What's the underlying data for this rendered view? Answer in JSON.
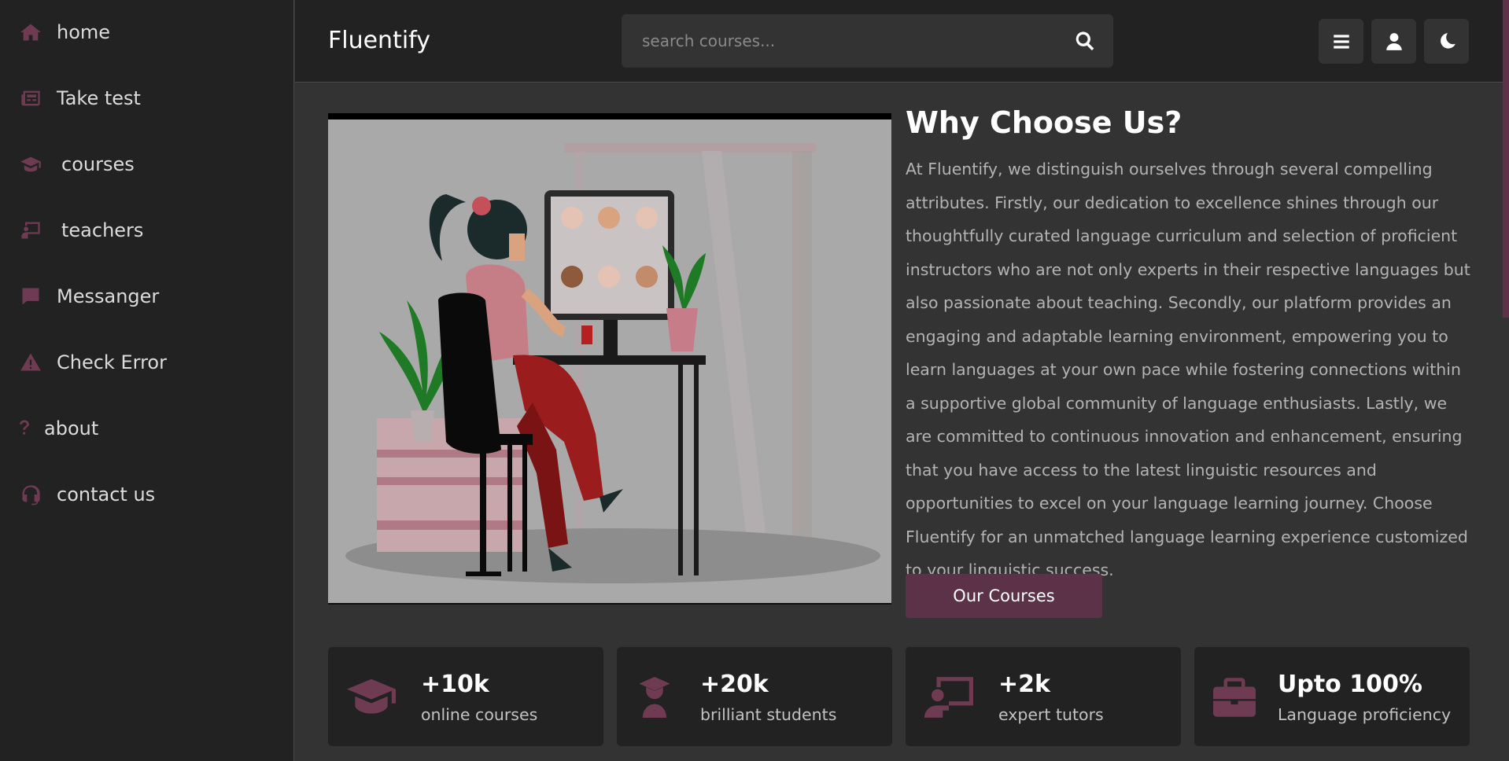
{
  "sidebar": {
    "items": [
      {
        "label": "home",
        "icon": "home-icon"
      },
      {
        "label": "Take test",
        "icon": "newspaper-icon"
      },
      {
        "label": "courses",
        "icon": "graduation-cap-icon"
      },
      {
        "label": "teachers",
        "icon": "chalkboard-teacher-icon"
      },
      {
        "label": "Messanger",
        "icon": "message-icon"
      },
      {
        "label": "Check Error",
        "icon": "warning-icon"
      },
      {
        "label": "about",
        "icon": "question-icon"
      },
      {
        "label": "contact us",
        "icon": "headset-icon"
      }
    ]
  },
  "header": {
    "brand": "Fluentify",
    "search_placeholder": "search courses...",
    "search_value": ""
  },
  "about": {
    "title": "Why Choose Us?",
    "text": "At Fluentify, we distinguish ourselves through several compelling attributes. Firstly, our dedication to excellence shines through our thoughtfully curated language curriculum and selection of proficient instructors who are not only experts in their respective languages but also passionate about teaching. Secondly, our platform provides an engaging and adaptable learning environment, empowering you to learn languages at your own pace while fostering connections within a supportive global community of language enthusiasts. Lastly, we are committed to continuous innovation and enhancement, ensuring that you have access to the latest linguistic resources and opportunities to excel on your language learning journey. Choose Fluentify for an unmatched language learning experience customized to your linguistic success.",
    "button_label": "Our Courses"
  },
  "stats": [
    {
      "value": "+10k",
      "label": "online courses",
      "icon": "graduation-cap-icon"
    },
    {
      "value": "+20k",
      "label": "brilliant students",
      "icon": "user-graduate-icon"
    },
    {
      "value": "+2k",
      "label": "expert tutors",
      "icon": "chalkboard-teacher-icon"
    },
    {
      "value": "Upto 100%",
      "label": "Language proficiency",
      "icon": "briefcase-icon"
    }
  ],
  "colors": {
    "accent": "#6e3b52",
    "button": "#5b3247",
    "panel": "#222222",
    "background": "#333333"
  }
}
